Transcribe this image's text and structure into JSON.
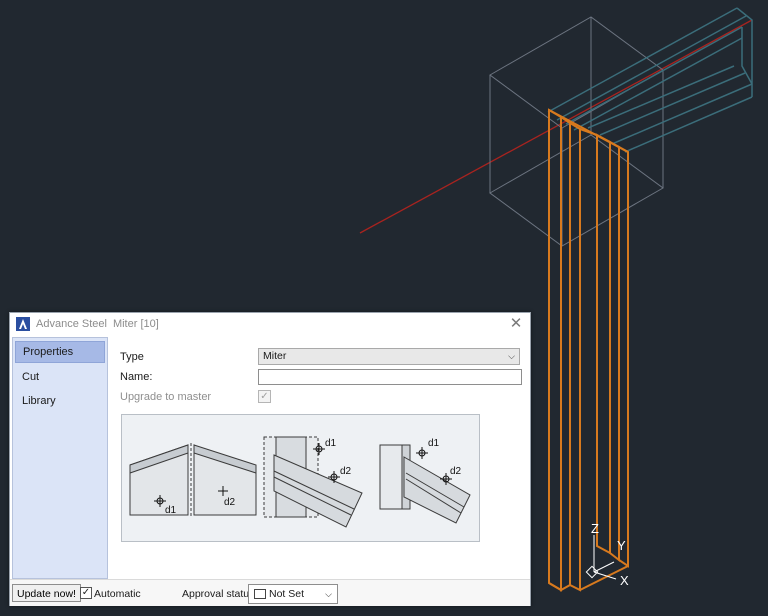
{
  "dialog": {
    "app_name": "Advance Steel",
    "object_name": "Miter [10]",
    "close_glyph": "✕",
    "sidebar": {
      "items": [
        {
          "label": "Properties",
          "active": true
        },
        {
          "label": "Cut",
          "active": false
        },
        {
          "label": "Library",
          "active": false
        }
      ]
    },
    "properties": {
      "type_label": "Type",
      "type_value": "Miter",
      "name_label": "Name:",
      "name_value": "",
      "upgrade_label": "Upgrade to master",
      "upgrade_checked": true
    },
    "preview": {
      "labels": [
        "d1",
        "d2",
        "d1",
        "d2",
        "d1",
        "d2"
      ]
    },
    "footer": {
      "update_button": "Update now!",
      "automatic_label": "Automatic",
      "automatic_checked": true,
      "approval_label": "Approval status",
      "approval_value": "Not Set"
    }
  },
  "viewport": {
    "axis_labels": {
      "z": "Z",
      "y": "Y",
      "x": "X"
    }
  },
  "colors": {
    "background": "#212830",
    "beam_orange": "#d87a1e",
    "wire_teal": "#3b6d7a",
    "axis_red": "#a8231f",
    "sidebar_active": "#a6b9e6"
  }
}
